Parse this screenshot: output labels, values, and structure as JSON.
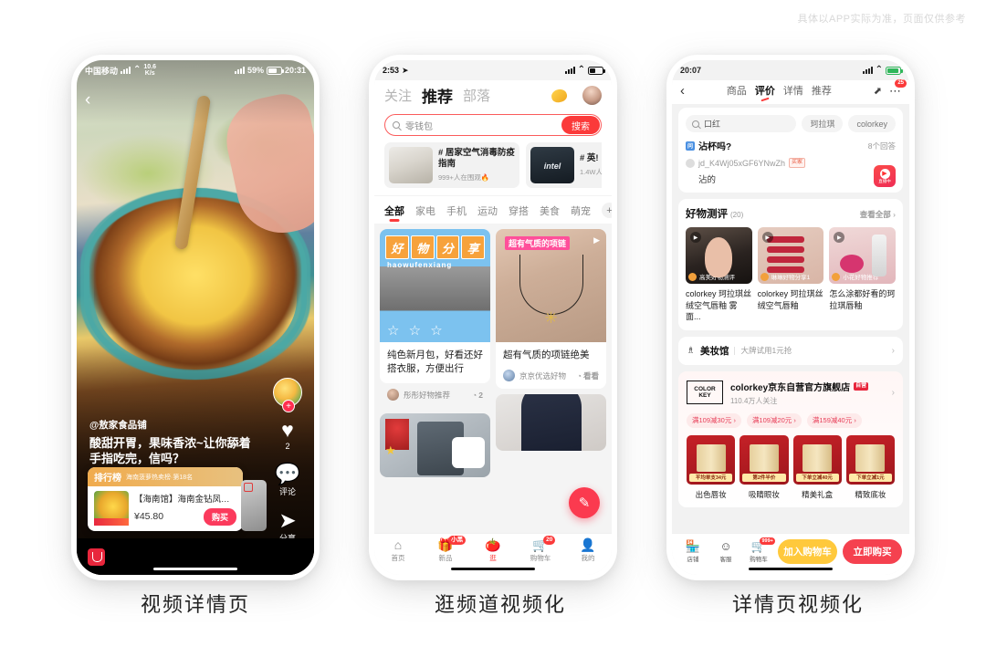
{
  "watermark": "具体以APP实际为准，页面仅供参考",
  "captions": [
    {
      "label": "视频详情页"
    },
    {
      "label": "逛频道视频化"
    },
    {
      "label": "详情页视频化"
    }
  ],
  "phone1": {
    "status": {
      "carrier": "中国移动",
      "speed_value": "10.6",
      "speed_unit": "K/s",
      "battery": "59%",
      "time": "20:31"
    },
    "back_icon": "chevron-left-icon",
    "rail": {
      "follow_plus": "+",
      "like_icon": "♥",
      "like_count": "2",
      "comment_icon": "💬",
      "comment_label": "评论",
      "share_icon": "➤",
      "share_label": "分享"
    },
    "author": "@敖家食品铺",
    "title": "酸甜开胃，果味香浓~让你舔着手指吃完，信吗？",
    "product_card": {
      "rank_label": "排行榜",
      "rank_sub": "海南菠萝热卖榜·第18名",
      "name": "【海南馆】海南金钻凤梨...",
      "price": "¥45.80",
      "buy_label": "购买"
    }
  },
  "phone2": {
    "status": {
      "time": "2:53"
    },
    "tabs": [
      {
        "label": "关注",
        "active": false
      },
      {
        "label": "推荐",
        "active": true
      },
      {
        "label": "部落",
        "active": false
      }
    ],
    "coin_icon": "coin-icon",
    "avatar_icon": "avatar",
    "search": {
      "placeholder": "零钱包",
      "button_label": "搜索",
      "icon": "search-icon"
    },
    "topic_cards": [
      {
        "title": "# 居家空气消毒防疫指南",
        "sub": "999+人在围观🔥"
      },
      {
        "title": "# 英!",
        "sub": "1.4W人"
      }
    ],
    "categories": [
      {
        "label": "全部",
        "active": true
      },
      {
        "label": "家电",
        "active": false
      },
      {
        "label": "手机",
        "active": false
      },
      {
        "label": "运动",
        "active": false
      },
      {
        "label": "穿搭",
        "active": false
      },
      {
        "label": "美食",
        "active": false
      },
      {
        "label": "萌宠",
        "active": false
      }
    ],
    "add_category_icon": "+",
    "feed": [
      {
        "overlay_title": "好物分享",
        "overlay_pinyin": "haowufenxiang",
        "text": "纯色新月包，好看还好搭衣服，方便出行",
        "user": "彤彤好物推荐",
        "likes": "2"
      },
      {
        "overlay_title": "超有气质的项链",
        "text": "超有气质的项链绝美",
        "user": "京京优选好物",
        "likes": "看看"
      }
    ],
    "fab_icon": "pencil-icon",
    "nav": [
      {
        "label": "首页",
        "icon": "home-icon",
        "badge": "",
        "active": false
      },
      {
        "label": "新品",
        "icon": "gift-icon",
        "badge": "小黑",
        "active": false
      },
      {
        "label": "逛",
        "icon": "discover-icon",
        "badge": "",
        "active": true
      },
      {
        "label": "购物车",
        "icon": "cart-icon",
        "badge": "20",
        "active": false
      },
      {
        "label": "我的",
        "icon": "person-icon",
        "badge": "",
        "active": false
      }
    ]
  },
  "phone3": {
    "status": {
      "time": "20:07"
    },
    "nav_tabs": [
      {
        "label": "商品",
        "active": false
      },
      {
        "label": "评价",
        "active": true
      },
      {
        "label": "详情",
        "active": false
      },
      {
        "label": "推荐",
        "active": false
      }
    ],
    "share_icon": "share-icon",
    "more_icon": "more-icon",
    "more_badge": "25",
    "qa": {
      "search_placeholder": "口红",
      "chips": [
        "珂拉琪",
        "colorkey"
      ],
      "question_tag": "问",
      "question": "沾杯吗?",
      "answer_count": "8个回答",
      "answer_user": "jd_K4Wj05xGF6YNwZh",
      "answer_badge": "买家",
      "answer_text": "沾的",
      "live_label": "直播中"
    },
    "reviews": {
      "title": "好物测评",
      "count": "(20)",
      "see_all": "查看全部",
      "videos": [
        {
          "user": "高美好物测评",
          "text": "colorkey 珂拉琪丝绒空气唇釉 雾面..."
        },
        {
          "user": "琳琳好物分享1",
          "text": "colorkey 珂拉琪丝绒空气唇釉"
        },
        {
          "user": "小花好物推荐",
          "text": "怎么涂都好看的珂拉琪唇釉"
        }
      ]
    },
    "beauty_row": {
      "icon": "beauty-icon",
      "title": "美妆馆",
      "sub": "大牌试用1元抢",
      "arrow": "›"
    },
    "shop": {
      "logo_line1": "COLOR",
      "logo_line2": "KEY",
      "name": "colorkey京东自营官方旗舰店",
      "self_badge": "自营",
      "fans": "110.4万人关注",
      "coupons": [
        "满109减30元 ›",
        "满109减20元 ›",
        "满159减40元 ›"
      ],
      "products": [
        {
          "name": "出色唇妆",
          "tag": "平均单支34元"
        },
        {
          "name": "吸睛眼妆",
          "tag": "第2件半价"
        },
        {
          "name": "精美礼盒",
          "tag": "下单立减40元"
        },
        {
          "name": "精致底妆",
          "tag": "下单立减1元"
        }
      ]
    },
    "bottom": {
      "items": [
        {
          "label": "店铺",
          "icon": "shop-icon",
          "badge": ""
        },
        {
          "label": "客服",
          "icon": "service-icon",
          "badge": ""
        },
        {
          "label": "购物车",
          "icon": "cart-icon",
          "badge": "999+"
        }
      ],
      "add_cart_label": "加入购物车",
      "buy_now_label": "立即购买"
    }
  }
}
